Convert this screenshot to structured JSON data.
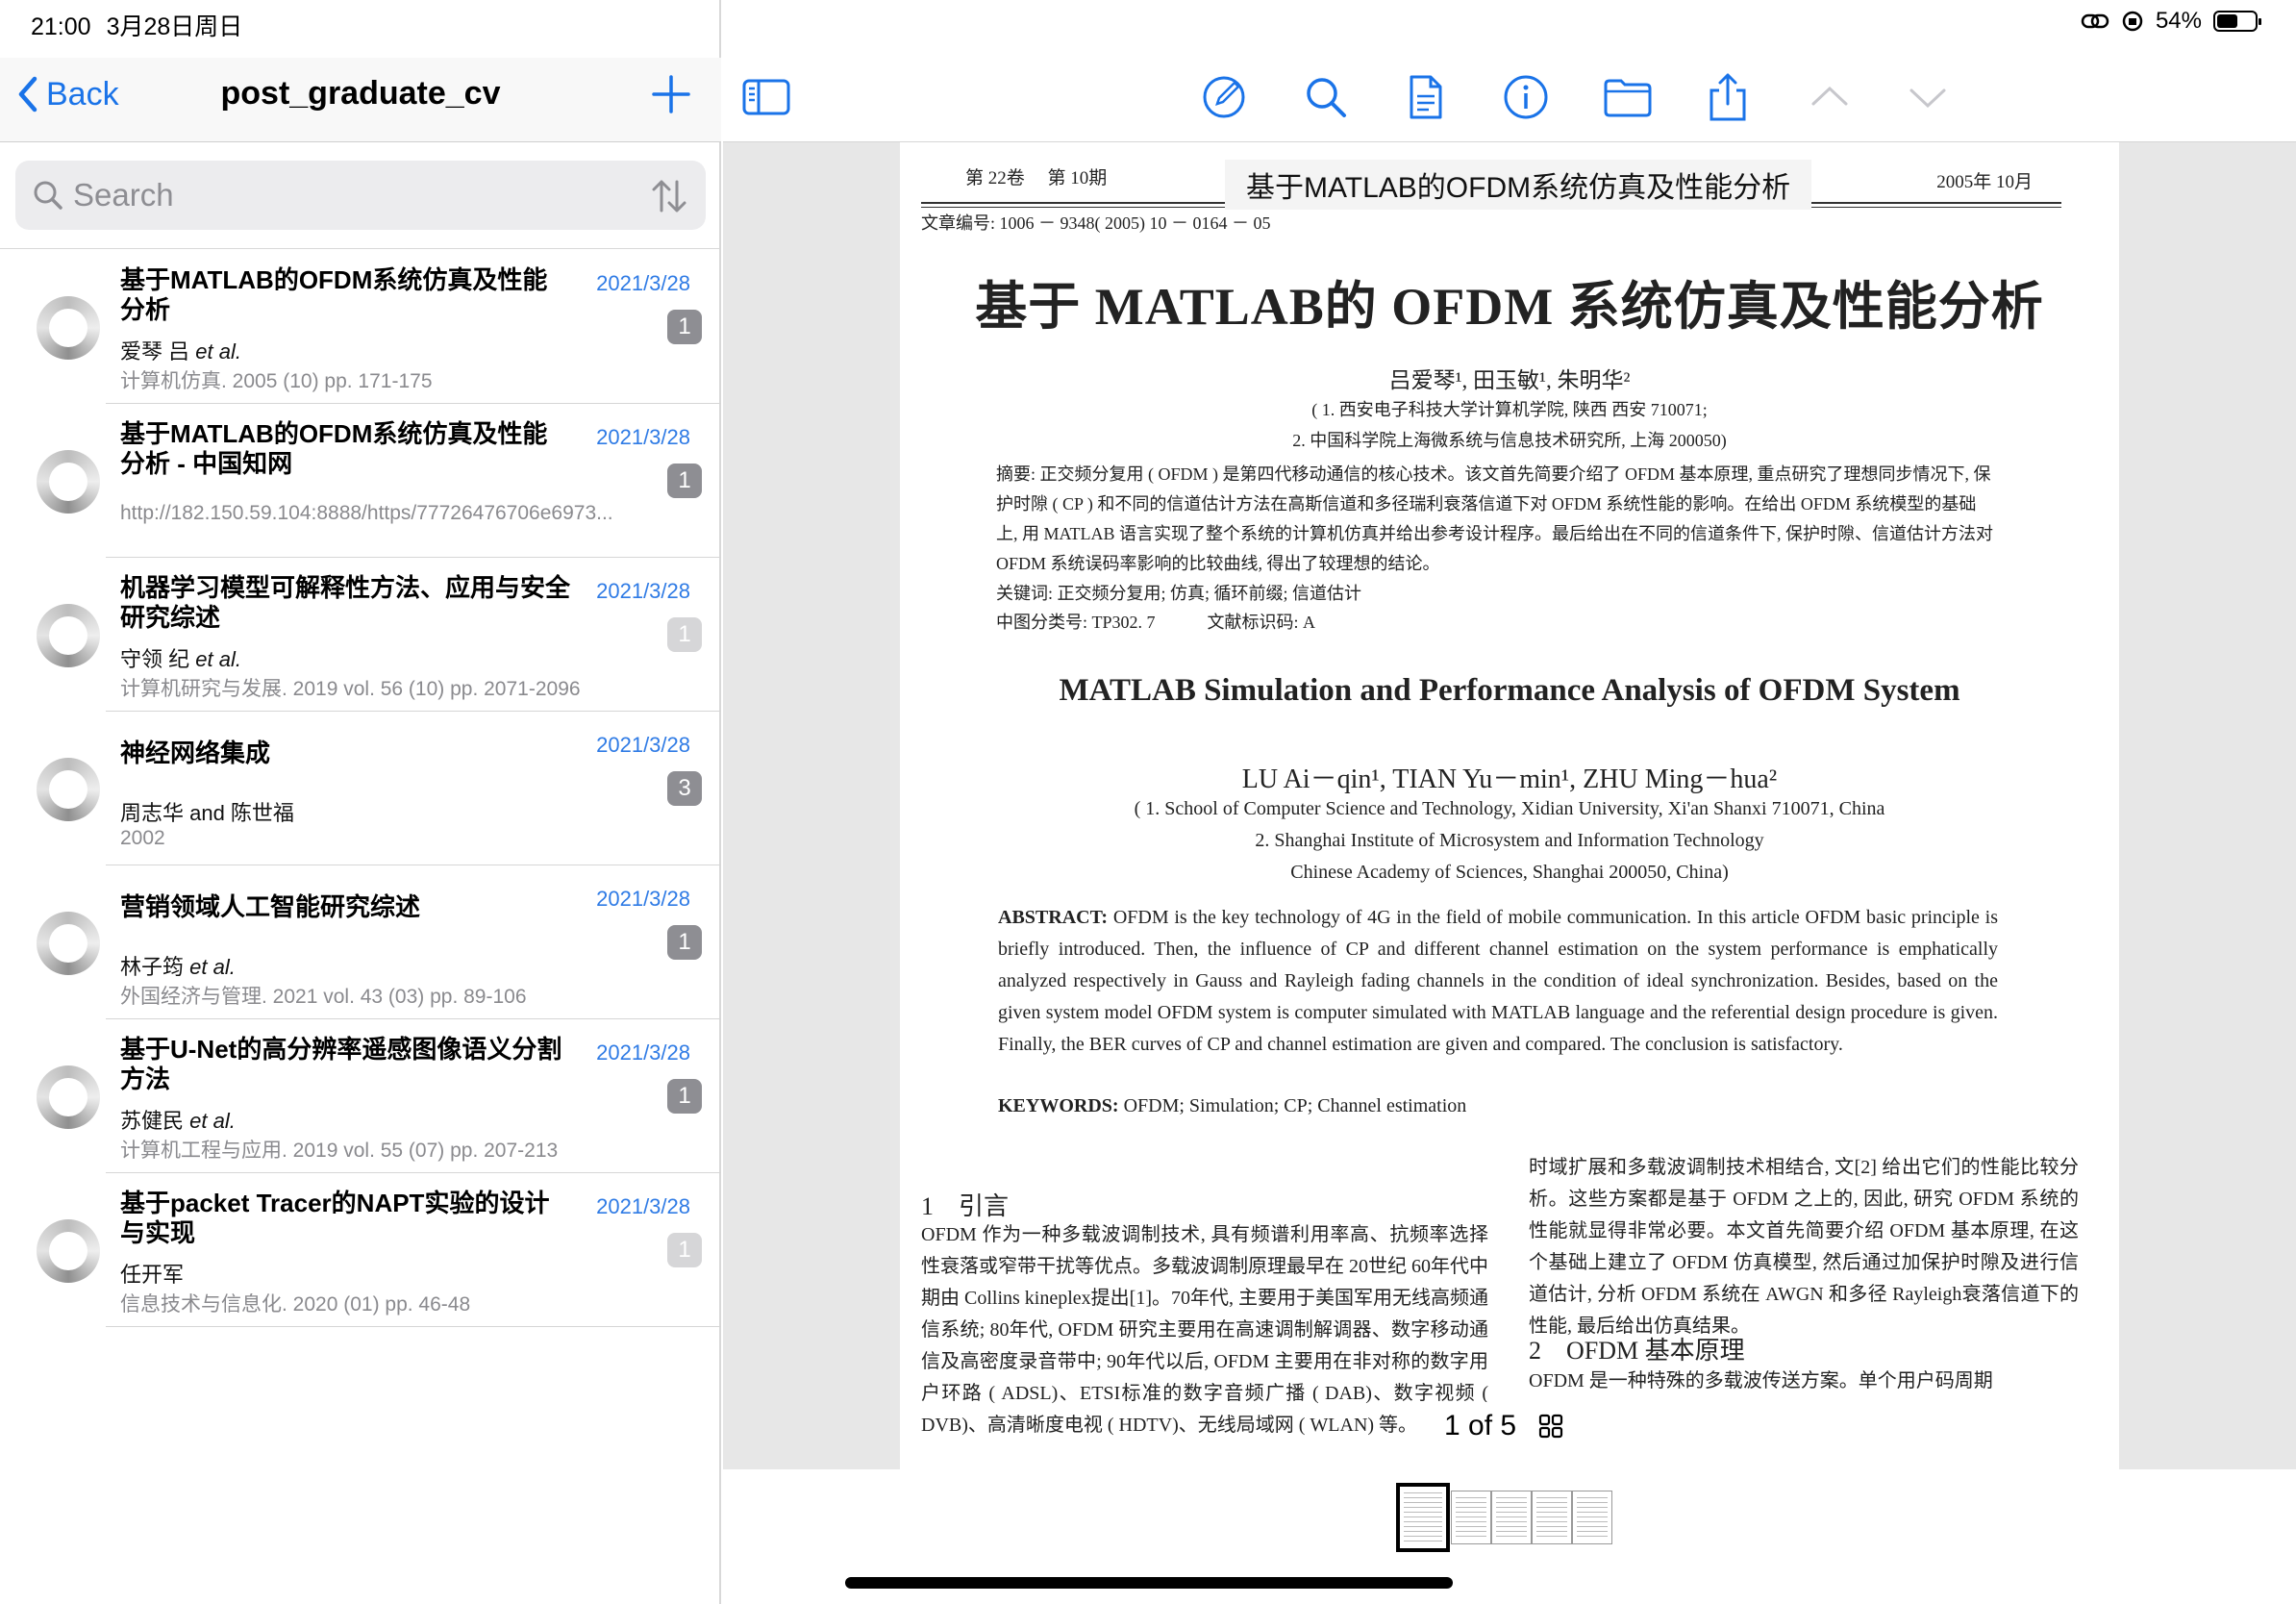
{
  "status": {
    "time": "21:00",
    "date": "3月28日周日",
    "battery": "54%",
    "battery_level": 0.54
  },
  "sidebar": {
    "back_label": "Back",
    "title": "post_graduate_cv",
    "search": {
      "placeholder": "Search",
      "value": ""
    },
    "items": [
      {
        "title": "基于MATLAB的OFDM系统仿真及性能分析",
        "date": "2021/3/28",
        "badge": "1",
        "badge_style": "dark",
        "authors": "爱琴 吕",
        "et_al": "et al.",
        "meta": "计算机仿真. 2005 (10) pp. 171-175"
      },
      {
        "title": "基于MATLAB的OFDM系统仿真及性能分析 - 中国知网",
        "date": "2021/3/28",
        "badge": "1",
        "badge_style": "dark",
        "authors": "",
        "et_al": "",
        "meta": "http://182.150.59.104:8888/https/77726476706e6973..."
      },
      {
        "title": "机器学习模型可解释性方法、应用与安全研究综述",
        "date": "2021/3/28",
        "badge": "1",
        "badge_style": "light",
        "authors": "守领 纪",
        "et_al": "et al.",
        "meta": "计算机研究与发展. 2019 vol. 56 (10) pp. 2071-2096"
      },
      {
        "title": "神经网络集成",
        "date": "2021/3/28",
        "badge": "3",
        "badge_style": "dark",
        "authors": "周志华 and 陈世福",
        "et_al": "",
        "meta": "2002"
      },
      {
        "title": "营销领域人工智能研究综述",
        "date": "2021/3/28",
        "badge": "1",
        "badge_style": "dark",
        "authors": "林子筠",
        "et_al": "et al.",
        "meta": "外国经济与管理. 2021 vol. 43 (03) pp. 89-106"
      },
      {
        "title": "基于U-Net的高分辨率遥感图像语义分割方法",
        "date": "2021/3/28",
        "badge": "1",
        "badge_style": "dark",
        "authors": "苏健民",
        "et_al": "et al.",
        "meta": "计算机工程与应用. 2019 vol. 55 (07) pp. 207-213"
      },
      {
        "title": "基于packet Tracer的NAPT实验的设计与实现",
        "date": "2021/3/28",
        "badge": "1",
        "badge_style": "light",
        "authors": "任开军",
        "et_al": "",
        "meta": "信息技术与信息化. 2020 (01) pp. 46-48"
      }
    ]
  },
  "toolbar": {
    "icons": [
      "sidebar-toggle-icon",
      "annotate-icon",
      "search-icon",
      "document-icon",
      "info-icon",
      "folder-icon",
      "share-icon",
      "chevron-up-icon",
      "chevron-down-icon"
    ],
    "accent": "#1a73e8"
  },
  "document": {
    "header_left": "第 22卷　 第 10期",
    "header_mid": "基于MATLAB的OFDM系统仿真及性能分析",
    "header_right": "2005年 10月",
    "doc_no": "文章编号: 1006 － 9348( 2005) 10 － 0164 － 05",
    "title": "基于 MATLAB的 OFDM 系统仿真及性能分析",
    "authors": "吕爱琴¹, 田玉敏¹, 朱明华²",
    "aff1": "( 1. 西安电子科技大学计算机学院, 陕西 西安 710071;",
    "aff2": "2. 中国科学院上海微系统与信息技术研究所, 上海 200050)",
    "abstract": "摘要: 正交频分复用 ( OFDM ) 是第四代移动通信的核心技术。该文首先简要介绍了 OFDM 基本原理, 重点研究了理想同步情况下, 保护时隙 ( CP ) 和不同的信道估计方法在高斯信道和多径瑞利衰落信道下对 OFDM 系统性能的影响。在给出 OFDM 系统模型的基础上, 用 MATLAB 语言实现了整个系统的计算机仿真并给出参考设计程序。最后给出在不同的信道条件下, 保护时隙、信道估计方法对 OFDM 系统误码率影响的比较曲线, 得出了较理想的结论。",
    "keywords": "关键词: 正交频分复用; 仿真; 循环前缀; 信道估计",
    "classification": "中图分类号: TP302. 7　　　文献标识码: A",
    "en_title": "MATLAB Simulation and Performance Analysis of OFDM System",
    "en_authors": "LU Ai－qin¹, TIAN Yu－min¹, ZHU Ming－hua²",
    "en_aff1": "( 1. School of Computer Science and Technology, Xidian University, Xi'an Shanxi 710071, China",
    "en_aff2": "2. Shanghai Institute of Microsystem and Information Technology",
    "en_aff3": "Chinese Academy of Sciences, Shanghai 200050, China)",
    "en_abstract_label": "ABSTRACT:",
    "en_abstract": " OFDM is the key technology of 4G in the field of mobile communication. In this article OFDM basic principle is briefly introduced. Then, the influence of CP and different channel estimation on the system performance is emphatically analyzed respectively in Gauss and Rayleigh fading channels in the condition of ideal synchronization. Besides, based on the given system model OFDM system is computer simulated with MATLAB language and the referential design procedure is given. Finally, the BER curves of CP and channel estimation are given and compared. The conclusion is satisfactory.",
    "en_keywords_label": "KEYWORDS:",
    "en_keywords": " OFDM; Simulation; CP; Channel estimation",
    "sec1_heading": "1　引言",
    "col_left": "OFDM 作为一种多载波调制技术, 具有频谱利用率高、抗频率选择性衰落或窄带干扰等优点。多载波调制原理最早在 20世纪 60年代中期由 Collins kineplex提出[1]。70年代, 主要用于美国军用无线高频通信系统; 80年代, OFDM 研究主要用在高速调制解调器、数字移动通信及高密度录音带中; 90年代以后, OFDM 主要用在非对称的数字用户环路 ( ADSL)、ETSI标准的数字音频广播 ( DAB)、数字视频 ( DVB)、高清晰度电视 ( HDTV)、无线局域网 ( WLAN) 等。",
    "col_right": "时域扩展和多载波调制技术相结合, 文[2] 给出它们的性能比较分析。这些方案都是基于 OFDM 之上的, 因此, 研究 OFDM 系统的性能就显得非常必要。本文首先简要介绍 OFDM 基本原理, 在这个基础上建立了 OFDM 仿真模型, 然后通过加保护时隙及进行信道估计, 分析 OFDM 系统在 AWGN 和多径 Rayleigh衰落信道下的性能, 最后给出仿真结果。",
    "sec2_heading": "2　OFDM 基本原理",
    "sec2_text": "OFDM 是一种特殊的多载波传送方案。单个用户码周期"
  },
  "page_indicator": "1 of 5",
  "thumbnails": {
    "count": 5,
    "active": 0
  }
}
